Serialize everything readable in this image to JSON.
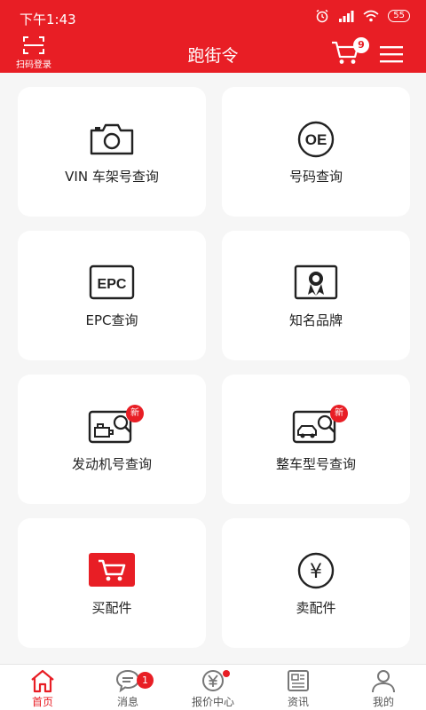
{
  "status_bar": {
    "time": "下午1:43",
    "battery": "55"
  },
  "header": {
    "scan_label": "扫码登录",
    "title": "跑街令",
    "cart_count": "9"
  },
  "cards": [
    {
      "label": "VIN 车架号查询",
      "icon": "camera-icon"
    },
    {
      "label": "号码查询",
      "icon": "oe-icon",
      "icon_text": "OE"
    },
    {
      "label": "EPC查询",
      "icon": "epc-icon",
      "icon_text": "EPC"
    },
    {
      "label": "知名品牌",
      "icon": "award-badge-icon"
    },
    {
      "label": "发动机号查询",
      "icon": "engine-search-icon",
      "badge": "新"
    },
    {
      "label": "整车型号查询",
      "icon": "car-search-icon",
      "badge": "新"
    },
    {
      "label": "买配件",
      "icon": "shopping-cart-icon"
    },
    {
      "label": "卖配件",
      "icon": "yen-icon",
      "icon_text": "¥"
    }
  ],
  "tabs": [
    {
      "label": "首页",
      "icon": "home-icon",
      "active": true
    },
    {
      "label": "消息",
      "icon": "message-icon",
      "badge": "1"
    },
    {
      "label": "报价中心",
      "icon": "quote-center-icon",
      "dot": true
    },
    {
      "label": "资讯",
      "icon": "news-icon"
    },
    {
      "label": "我的",
      "icon": "profile-icon"
    }
  ],
  "colors": {
    "brand_red": "#e81e25",
    "background": "#f6f6f6",
    "card": "#ffffff"
  }
}
